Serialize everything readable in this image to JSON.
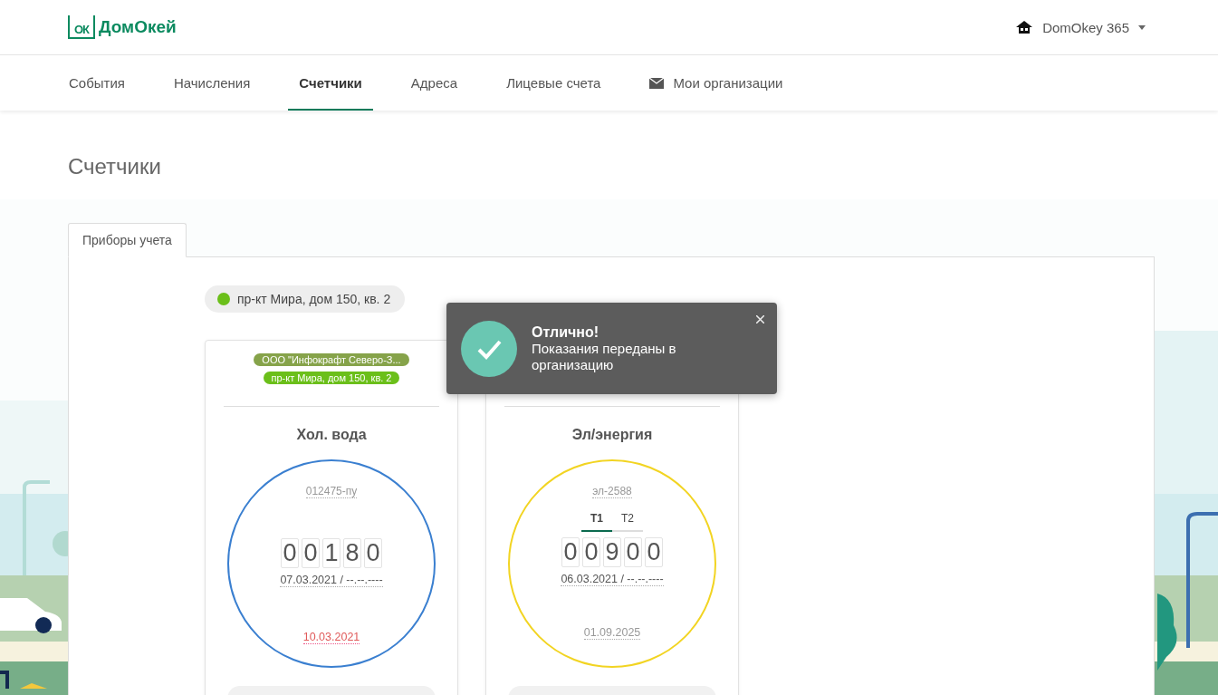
{
  "header": {
    "logo_mark": "ОК",
    "logo_text": "ДомОкей",
    "user": {
      "name": "DomOkey 365"
    }
  },
  "nav": [
    {
      "label": "События",
      "selected": false
    },
    {
      "label": "Начисления",
      "selected": false
    },
    {
      "label": "Счетчики",
      "selected": true
    },
    {
      "label": "Адреса",
      "selected": false
    },
    {
      "label": "Лицевые счета",
      "selected": false
    },
    {
      "label": "Мои организации",
      "selected": false,
      "kind": "mail"
    }
  ],
  "page_title": "Счетчики",
  "tabs": [
    {
      "label": "Приборы учета",
      "selected": true
    }
  ],
  "address_filter": {
    "label": "пр-кт Мира, дом 150, кв. 2",
    "color": "#6bbf1a"
  },
  "meters": [
    {
      "tags": [
        {
          "text": "ООО \"Инфокрафт Северо-З...",
          "color": "#86a34a"
        },
        {
          "text": "пр-кт Мира, дом 150, кв. 2",
          "color": "#6bbf1a"
        }
      ],
      "title": "Хол. вода",
      "color": "#3a7fd0",
      "serial": "012475-пу",
      "digits": [
        "0",
        "0",
        "1",
        "8",
        "0"
      ],
      "dates": "07.03.2021 / --.--.----",
      "check_date": "10.03.2021",
      "overdue": true
    },
    {
      "title": "Эл/энергия",
      "color": "#f2d422",
      "serial": "эл-2588",
      "tariffs": [
        {
          "label": "T1",
          "selected": true
        },
        {
          "label": "T2",
          "selected": false
        }
      ],
      "digits": [
        "0",
        "0",
        "9",
        "0",
        "0"
      ],
      "dates": "06.03.2021 / --.--.----",
      "check_date": "01.09.2025",
      "overdue": false
    }
  ],
  "toast": {
    "title": "Отлично!",
    "message": "Показания переданы в организацию"
  }
}
